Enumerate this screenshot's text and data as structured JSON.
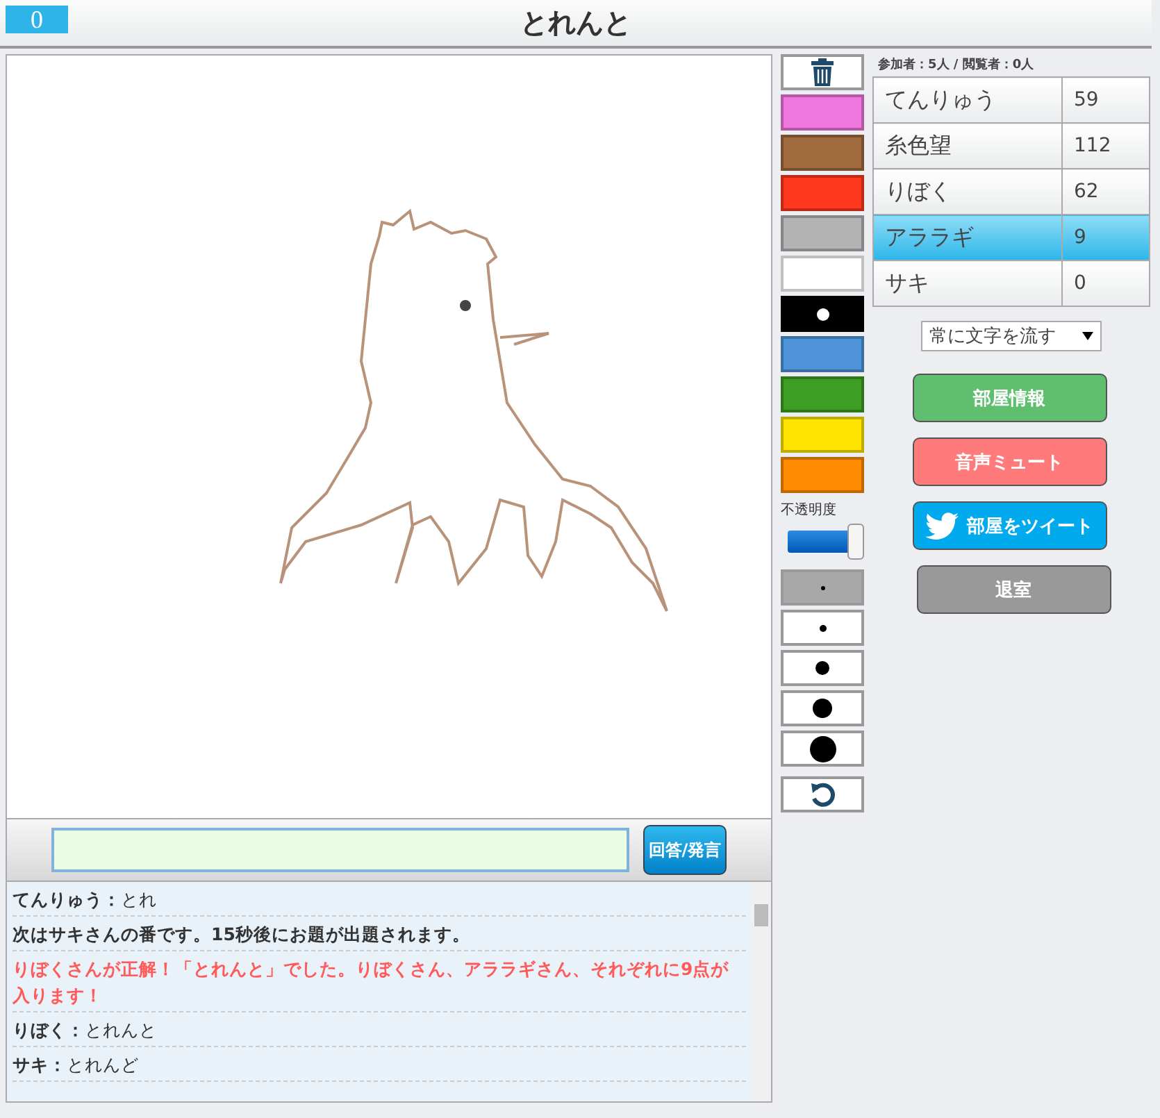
{
  "header": {
    "score": "0",
    "title": "とれんと"
  },
  "palette": {
    "colors": [
      {
        "color": "#ee77dd",
        "selected": false
      },
      {
        "color": "#9e6a3e",
        "selected": false
      },
      {
        "color": "#ff3920",
        "selected": false
      },
      {
        "color": "#b3b3b3",
        "selected": false
      },
      {
        "color": "#ffffff",
        "selected": false
      },
      {
        "color": "#000000",
        "selected": true
      },
      {
        "color": "#4f94d9",
        "selected": false
      },
      {
        "color": "#3c9e22",
        "selected": false
      },
      {
        "color": "#ffe600",
        "selected": false
      },
      {
        "color": "#ff8c00",
        "selected": false
      }
    ],
    "opacity_label": "不透明度",
    "opacity": {
      "level": 1
    },
    "sizes": [
      {
        "selected": true
      },
      {
        "selected": false
      },
      {
        "selected": false
      },
      {
        "selected": false
      },
      {
        "selected": false
      }
    ]
  },
  "room_info": "参加者：5人 / 閲覧者：0人",
  "players": [
    {
      "name": "てんりゅう",
      "score": "59",
      "selected": false
    },
    {
      "name": "糸色望",
      "score": "112",
      "selected": false
    },
    {
      "name": "りぼく",
      "score": "62",
      "selected": false
    },
    {
      "name": "アララギ",
      "score": "9",
      "selected": true
    },
    {
      "name": "サキ",
      "score": "0",
      "selected": false
    }
  ],
  "scroll_mode": "常に文字を流す",
  "buttons": [
    {
      "label": "部屋情報",
      "kind": "info"
    },
    {
      "label": "音声ミュート",
      "kind": "mute"
    },
    {
      "label": "部屋をツイート",
      "kind": "tweet"
    },
    {
      "label": "退室",
      "kind": "leave"
    }
  ],
  "answer": {
    "button": "回答/発言"
  },
  "messages": [
    {
      "kind": "chat",
      "name": "てんりゅう：",
      "text": "とれ"
    },
    {
      "kind": "system",
      "text": "次はサキさんの番です。15秒後にお題が出題されます。"
    },
    {
      "kind": "correct",
      "text": "りぼくさんが正解！「とれんと」でした。りぼくさん、アララギさん、それぞれに9点が入ります！"
    },
    {
      "kind": "chat",
      "name": "りぼく：",
      "text": "とれんと"
    },
    {
      "kind": "chat",
      "name": "サキ：",
      "text": "とれんど"
    }
  ]
}
